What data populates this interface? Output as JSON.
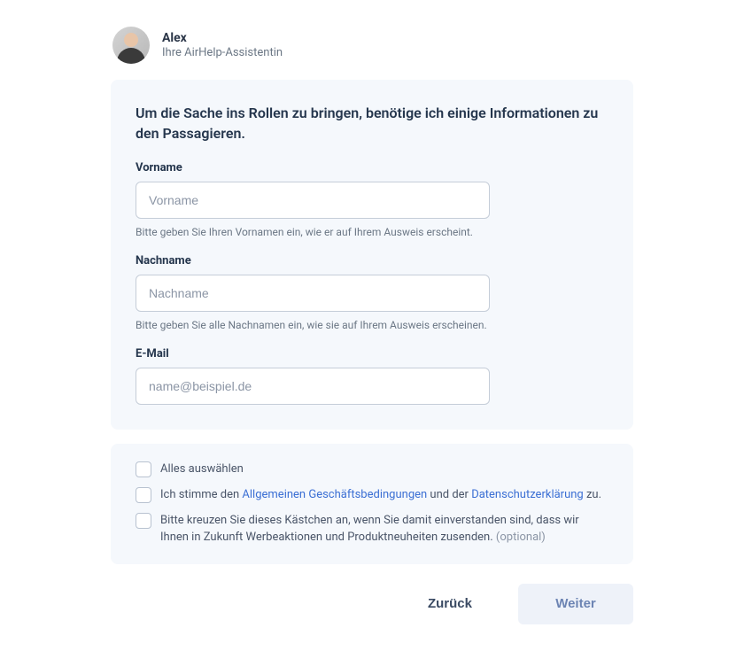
{
  "assistant": {
    "name": "Alex",
    "subtitle": "Ihre AirHelp-Assistentin"
  },
  "form": {
    "intro": "Um die Sache ins Rollen zu bringen, benötige ich einige Informationen zu den Passagieren.",
    "firstName": {
      "label": "Vorname",
      "placeholder": "Vorname",
      "hint": "Bitte geben Sie Ihren Vornamen ein, wie er auf Ihrem Ausweis erscheint."
    },
    "lastName": {
      "label": "Nachname",
      "placeholder": "Nachname",
      "hint": "Bitte geben Sie alle Nachnamen ein, wie sie auf Ihrem Ausweis erscheinen."
    },
    "email": {
      "label": "E-Mail",
      "placeholder": "name@beispiel.de"
    }
  },
  "consent": {
    "selectAll": "Alles auswählen",
    "terms": {
      "prefix": "Ich stimme den ",
      "link1": "Allgemeinen Geschäftsbedingungen",
      "middle": " und der ",
      "link2": "Datenschutzerklärung",
      "suffix": " zu."
    },
    "marketing": {
      "text": "Bitte kreuzen Sie dieses Kästchen an, wenn Sie damit einverstanden sind, dass wir Ihnen in Zukunft Werbeaktionen und Produktneuheiten zusenden. ",
      "optional": "(optional)"
    }
  },
  "buttons": {
    "back": "Zurück",
    "next": "Weiter"
  }
}
